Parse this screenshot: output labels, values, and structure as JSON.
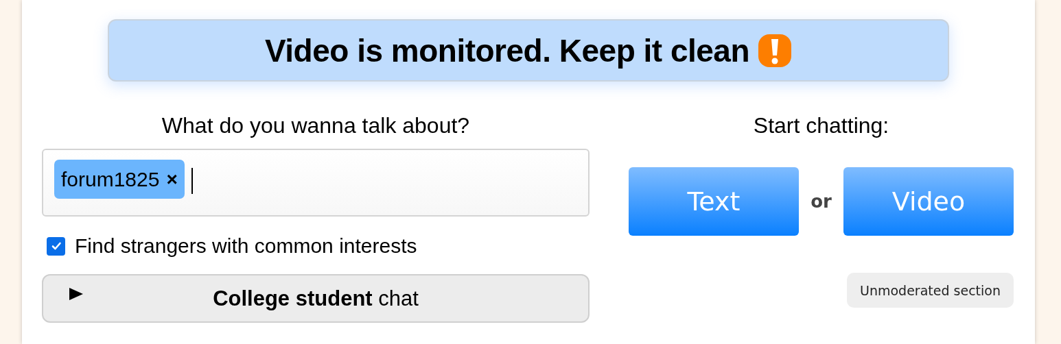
{
  "banner": {
    "text": "Video is monitored. Keep it clean"
  },
  "interests": {
    "heading": "What do you wanna talk about?",
    "tags": [
      {
        "label": "forum1825",
        "remove": "×"
      }
    ],
    "common_interests": {
      "label": "Find strangers with common interests",
      "checked": true
    }
  },
  "college": {
    "label": "**College student** chat",
    "expanded": false
  },
  "start": {
    "heading": "Start chatting:",
    "buttons": [
      {
        "label": "Text"
      },
      {
        "label": "Video"
      }
    ],
    "separator": "or"
  },
  "unmoderated": {
    "label": "Unmoderated section"
  }
}
